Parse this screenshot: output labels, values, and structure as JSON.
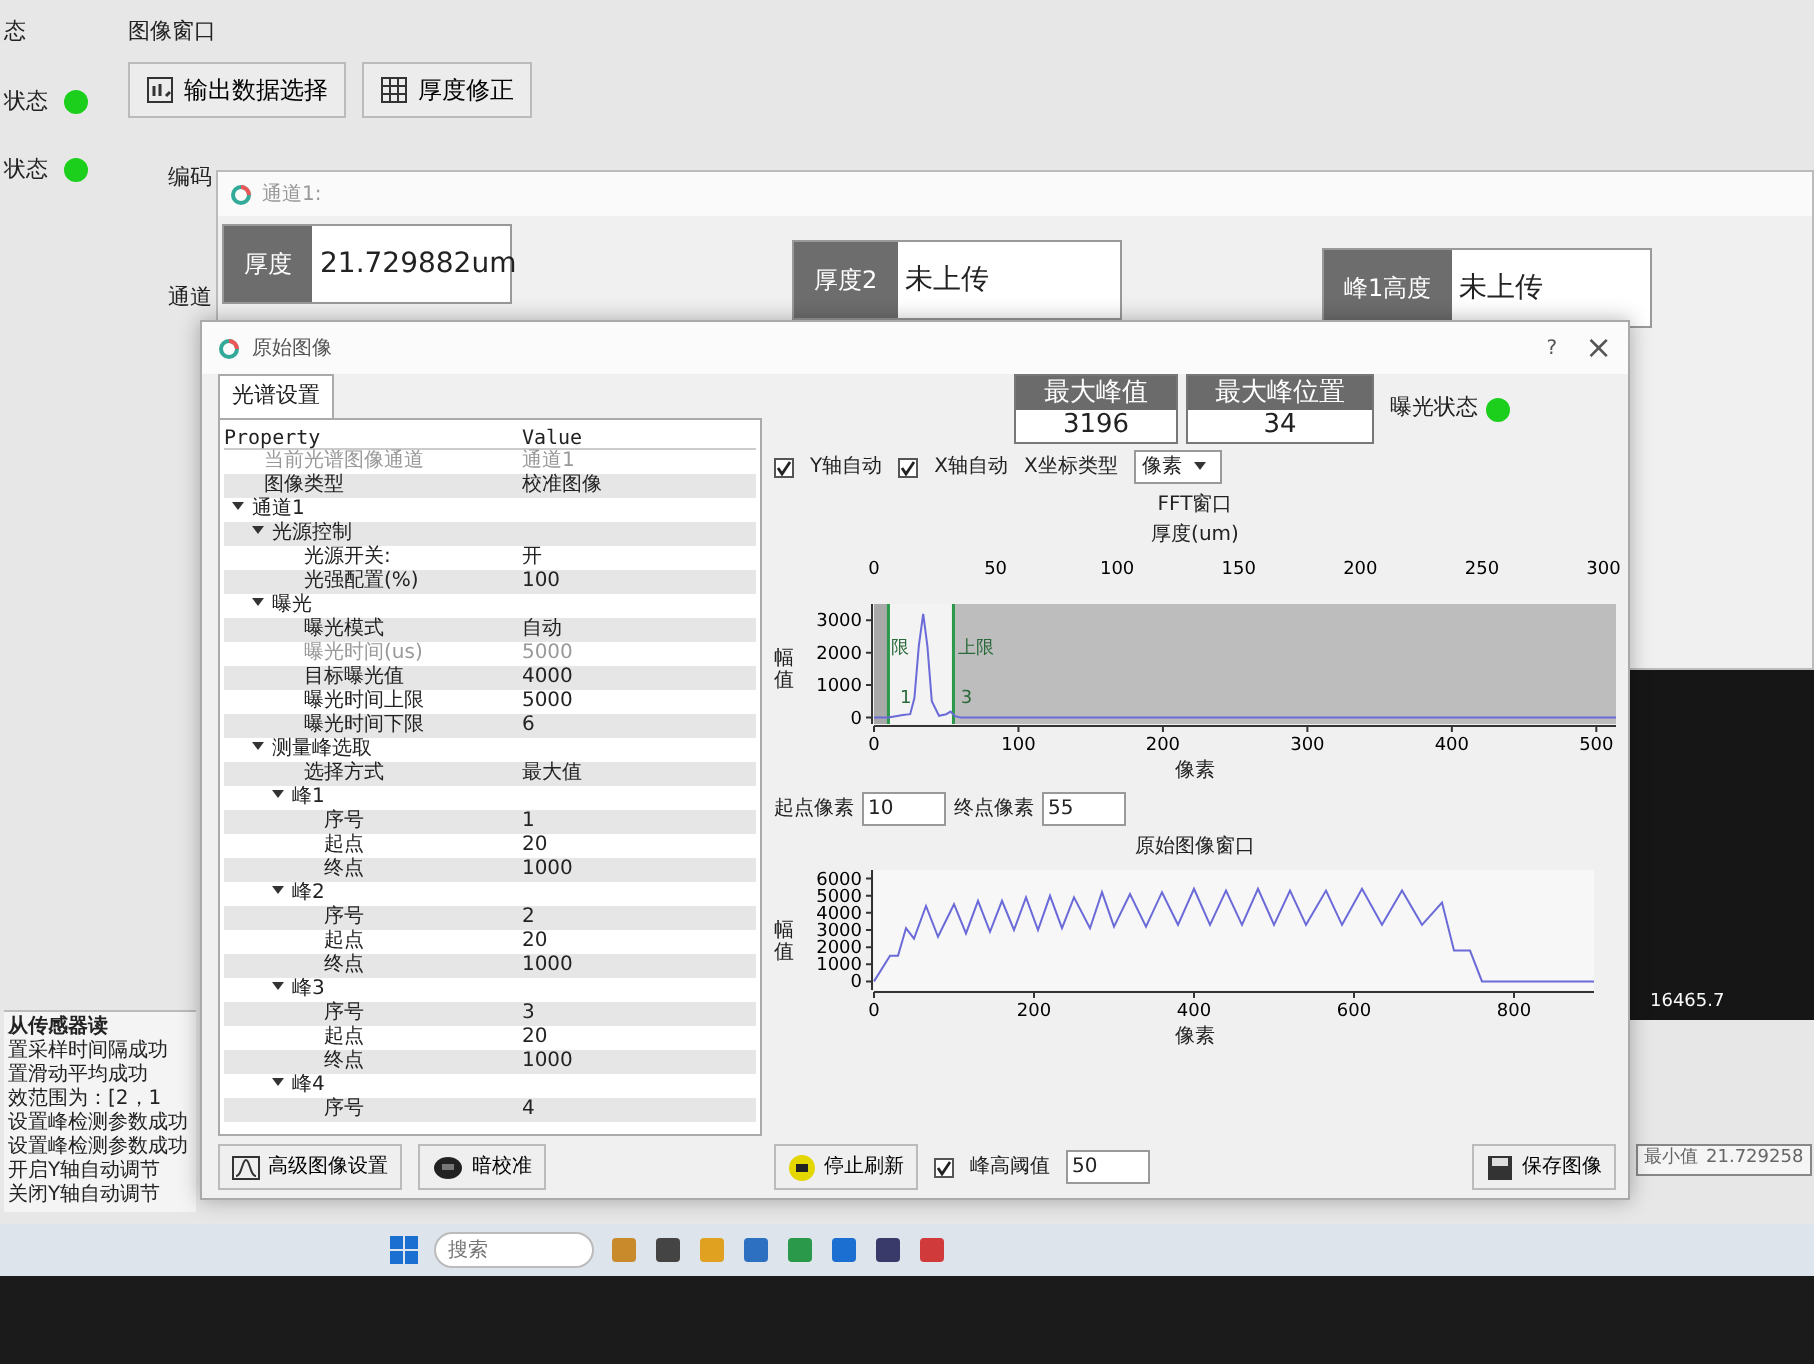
{
  "main_window": {
    "sidebar_title": "态",
    "title": "图像窗口",
    "status_rows": [
      {
        "label": "状态",
        "on": true
      },
      {
        "label": "状态",
        "on": true
      }
    ],
    "toolbar": [
      {
        "kind": "output",
        "label": "输出数据选择"
      },
      {
        "kind": "grid",
        "label": "厚度修正"
      }
    ],
    "group_labels": [
      "编码",
      "通道"
    ],
    "log": {
      "header": "从传感器读",
      "lines": [
        "置采样时间隔成功",
        "置滑动平均成功",
        "效范围为：[2，1",
        "设置峰检测参数成功",
        "设置峰检测参数成功",
        "开启Y轴自动调节",
        "关闭Y轴自动调节"
      ]
    },
    "plot_label": "16465.7",
    "min_field": {
      "label": "最小值",
      "value": "21.729258"
    }
  },
  "channel_window": {
    "title": "通道1:",
    "cells": [
      {
        "label": "厚度",
        "value": "21.729882um"
      },
      {
        "label": "厚度2",
        "value": "未上传"
      },
      {
        "label": "峰1高度",
        "value": "未上传"
      }
    ]
  },
  "dialog": {
    "title": "原始图像",
    "help": "?",
    "close": "×",
    "tabs": [
      {
        "label": "光谱设置",
        "selected": true
      }
    ],
    "property_table": {
      "columns": [
        "Property",
        "Value"
      ],
      "rows": [
        {
          "kind": "field",
          "label": "当前光谱图像通道",
          "value": "通道1",
          "disabled": true
        },
        {
          "kind": "field",
          "label": "图像类型",
          "value": "校准图像",
          "disabled": false
        },
        {
          "kind": "group",
          "label": "通道1",
          "expanded": true,
          "children": [
            {
              "kind": "group",
              "label": "光源控制",
              "expanded": true,
              "children": [
                {
                  "kind": "field",
                  "label": "光源开关:",
                  "value": "开",
                  "disabled": false
                },
                {
                  "kind": "field",
                  "label": "光强配置(%)",
                  "value": "100",
                  "disabled": false
                }
              ]
            },
            {
              "kind": "group",
              "label": "曝光",
              "expanded": true,
              "children": [
                {
                  "kind": "field",
                  "label": "曝光模式",
                  "value": "自动",
                  "disabled": false
                },
                {
                  "kind": "field",
                  "label": "曝光时间(us)",
                  "value": "5000",
                  "disabled": true
                },
                {
                  "kind": "field",
                  "label": "目标曝光值",
                  "value": "4000",
                  "disabled": false
                },
                {
                  "kind": "field",
                  "label": "曝光时间上限",
                  "value": "5000",
                  "disabled": false
                },
                {
                  "kind": "field",
                  "label": "曝光时间下限",
                  "value": "6",
                  "disabled": false
                }
              ]
            },
            {
              "kind": "group",
              "label": "测量峰选取",
              "expanded": true,
              "children": [
                {
                  "kind": "field",
                  "label": "选择方式",
                  "value": "最大值",
                  "disabled": false
                },
                {
                  "kind": "group",
                  "label": "峰1",
                  "expanded": true,
                  "children": [
                    {
                      "kind": "field",
                      "label": "序号",
                      "value": "1",
                      "disabled": false
                    },
                    {
                      "kind": "field",
                      "label": "起点",
                      "value": "20",
                      "disabled": false
                    },
                    {
                      "kind": "field",
                      "label": "终点",
                      "value": "1000",
                      "disabled": false
                    }
                  ]
                },
                {
                  "kind": "group",
                  "label": "峰2",
                  "expanded": true,
                  "children": [
                    {
                      "kind": "field",
                      "label": "序号",
                      "value": "2",
                      "disabled": false
                    },
                    {
                      "kind": "field",
                      "label": "起点",
                      "value": "20",
                      "disabled": false
                    },
                    {
                      "kind": "field",
                      "label": "终点",
                      "value": "1000",
                      "disabled": false
                    }
                  ]
                },
                {
                  "kind": "group",
                  "label": "峰3",
                  "expanded": true,
                  "children": [
                    {
                      "kind": "field",
                      "label": "序号",
                      "value": "3",
                      "disabled": false
                    },
                    {
                      "kind": "field",
                      "label": "起点",
                      "value": "20",
                      "disabled": false
                    },
                    {
                      "kind": "field",
                      "label": "终点",
                      "value": "1000",
                      "disabled": false
                    }
                  ]
                },
                {
                  "kind": "group",
                  "label": "峰4",
                  "expanded": true,
                  "children": [
                    {
                      "kind": "field",
                      "label": "序号",
                      "value": "4",
                      "disabled": false
                    }
                  ]
                }
              ]
            }
          ]
        }
      ]
    },
    "left_buttons": [
      {
        "kind": "curve",
        "label": "高级图像设置"
      },
      {
        "kind": "dark",
        "label": "暗校准"
      }
    ],
    "metrics": [
      {
        "label": "最大峰值",
        "value": "3196"
      },
      {
        "label": "最大峰位置",
        "value": "34"
      }
    ],
    "exposure_status": {
      "label": "曝光状态",
      "on": true
    },
    "axis_options": [
      {
        "label": "Y轴自动",
        "checked": true
      },
      {
        "label": "X轴自动",
        "checked": true
      }
    ],
    "x_type": {
      "label": "X坐标类型",
      "value": "像素"
    },
    "fft_chart": {
      "top_axis": {
        "label": "厚度(um)",
        "ticks": [
          "0",
          "50",
          "100",
          "150",
          "200",
          "250",
          "300"
        ]
      },
      "chart_data": {
        "type": "line",
        "title": "FFT窗口",
        "xlabel": "像素",
        "ylabel": "幅值",
        "xlim": [
          0,
          515
        ],
        "ylim": [
          -200,
          3500
        ],
        "xticks": [
          0,
          100,
          200,
          300,
          400,
          500
        ],
        "yticks": [
          0,
          1000,
          2000,
          3000
        ],
        "x": [
          0,
          10,
          20,
          25,
          28,
          31,
          34,
          37,
          40,
          45,
          50,
          53,
          56,
          60,
          100,
          200,
          300,
          400,
          500,
          515
        ],
        "series": [
          {
            "color": "#6a6ad8",
            "values": [
              0,
              0,
              80,
              100,
              600,
              2200,
              3200,
              2200,
              500,
              50,
              100,
              180,
              40,
              0,
              0,
              0,
              0,
              0,
              0,
              0
            ]
          }
        ],
        "bands": [
          {
            "axis": "x",
            "from": 0,
            "to": 10
          },
          {
            "axis": "x",
            "from": 55,
            "to": 515
          }
        ],
        "ref_lines": [
          {
            "axis": "x",
            "value": 10
          },
          {
            "axis": "x",
            "value": 55
          }
        ],
        "annotations": [
          "限",
          "上限",
          "1",
          "3"
        ]
      }
    },
    "range": [
      {
        "label": "起点像素",
        "value": "10"
      },
      {
        "label": "终点像素",
        "value": "55"
      }
    ],
    "raw_chart": {
      "chart_data": {
        "type": "line",
        "title": "原始图像窗口",
        "xlabel": "像素",
        "ylabel": "幅值",
        "xlim": [
          0,
          900
        ],
        "ylim": [
          -500,
          6500
        ],
        "xticks": [
          0,
          200,
          400,
          600,
          800
        ],
        "yticks": [
          0,
          1000,
          2000,
          3000,
          4000,
          5000,
          6000
        ],
        "x": [
          0,
          20,
          30,
          40,
          50,
          65,
          80,
          100,
          115,
          130,
          145,
          160,
          175,
          190,
          205,
          220,
          235,
          250,
          270,
          285,
          300,
          320,
          340,
          360,
          380,
          400,
          420,
          440,
          460,
          480,
          500,
          520,
          540,
          565,
          585,
          610,
          635,
          660,
          685,
          710,
          725,
          745,
          760,
          800,
          900
        ],
        "series": [
          {
            "color": "#6a6ad8",
            "values": [
              0,
              1500,
              1500,
              3100,
              2500,
              4400,
              2600,
              4500,
              2800,
              4700,
              2900,
              4700,
              3000,
              4900,
              3000,
              5000,
              3100,
              4900,
              3100,
              5200,
              3200,
              5100,
              3200,
              5200,
              3300,
              5400,
              3300,
              5300,
              3300,
              5400,
              3300,
              5300,
              3300,
              5300,
              3300,
              5400,
              3300,
              5300,
              3300,
              4600,
              1800,
              1800,
              0,
              0,
              0
            ]
          }
        ]
      }
    },
    "bottom": {
      "stop_button": "停止刷新",
      "threshold": {
        "label": "峰高阈值",
        "checked": true,
        "value": "50"
      },
      "save_button": "保存图像"
    }
  },
  "taskbar": {
    "search_placeholder": "搜索"
  }
}
